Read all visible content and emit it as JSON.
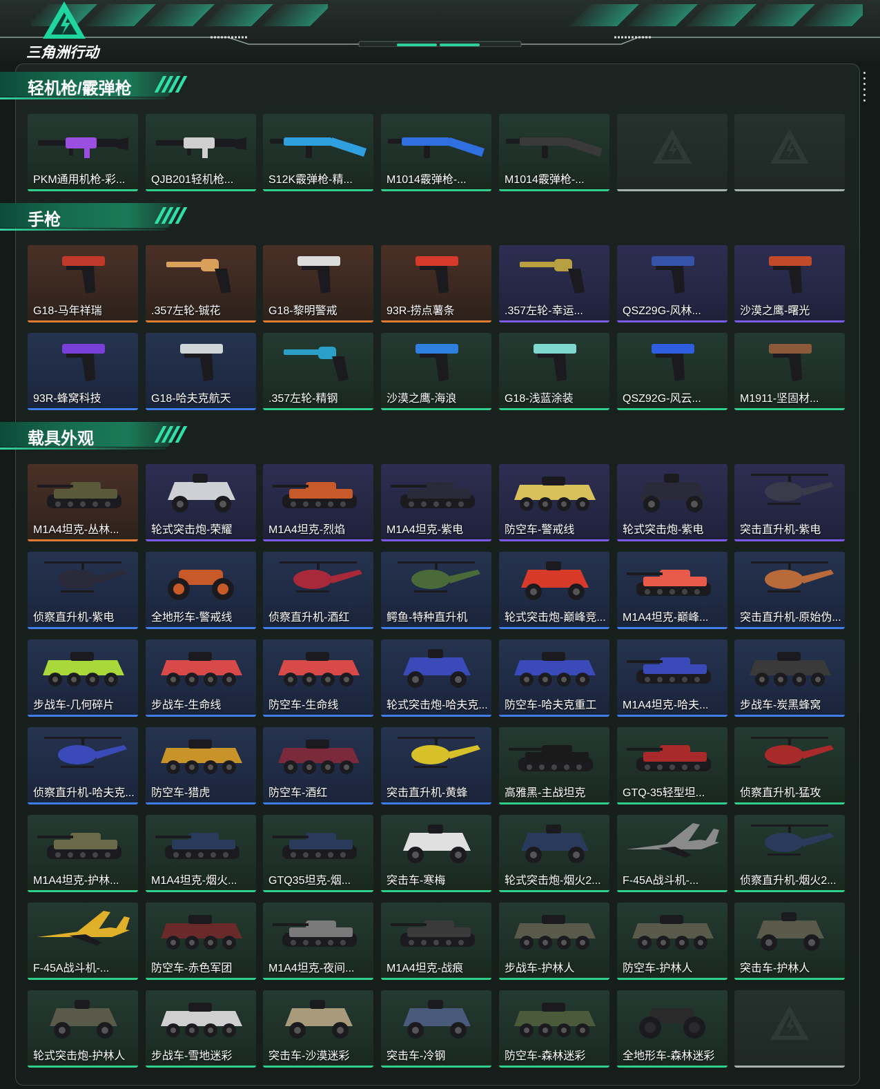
{
  "app": {
    "logo_text": "三角洲行动",
    "logo_icon": "delta-triangle-icon"
  },
  "sections": [
    {
      "title": "轻机枪/霰弹枪",
      "items": [
        {
          "name": "PKM通用机枪-彩...",
          "rarity": "green",
          "icon": "machine-gun-icon",
          "color": "#9a4fe0"
        },
        {
          "name": "QJB201轻机枪...",
          "rarity": "green",
          "icon": "machine-gun-icon",
          "color": "#cfcfcf"
        },
        {
          "name": "S12K霰弹枪-精...",
          "rarity": "green",
          "icon": "shotgun-icon",
          "color": "#2f9fe0"
        },
        {
          "name": "M1014霰弹枪-...",
          "rarity": "green",
          "icon": "shotgun-icon",
          "color": "#2f6fe0"
        },
        {
          "name": "M1014霰弹枪-...",
          "rarity": "green",
          "icon": "shotgun-icon",
          "color": "#3a3a3a"
        },
        {
          "name": "",
          "rarity": "empty",
          "icon": "empty-slot-icon",
          "color": ""
        },
        {
          "name": "",
          "rarity": "empty",
          "icon": "empty-slot-icon",
          "color": ""
        }
      ]
    },
    {
      "title": "手枪",
      "items": [
        {
          "name": "G18-马年祥瑞",
          "rarity": "orange",
          "icon": "pistol-icon",
          "color": "#c0392b"
        },
        {
          "name": ".357左轮-铖花",
          "rarity": "orange",
          "icon": "revolver-icon",
          "color": "#d9a05b"
        },
        {
          "name": "G18-黎明警戒",
          "rarity": "orange",
          "icon": "pistol-icon",
          "color": "#dcdcdc"
        },
        {
          "name": "93R-捞点薯条",
          "rarity": "orange",
          "icon": "pistol-icon",
          "color": "#d63a2a"
        },
        {
          "name": ".357左轮-幸运...",
          "rarity": "purple",
          "icon": "revolver-icon",
          "color": "#b8a040"
        },
        {
          "name": "QSZ29G-风林...",
          "rarity": "purple",
          "icon": "pistol-icon",
          "color": "#3553a8"
        },
        {
          "name": "沙漠之鹰-曙光",
          "rarity": "purple",
          "icon": "pistol-icon",
          "color": "#c04a2a"
        },
        {
          "name": "93R-蜂窝科技",
          "rarity": "blue",
          "icon": "pistol-icon",
          "color": "#7a3fd8"
        },
        {
          "name": "G18-哈夫克航天",
          "rarity": "blue",
          "icon": "pistol-icon",
          "color": "#cfd6d8"
        },
        {
          "name": ".357左轮-精钢",
          "rarity": "green",
          "icon": "revolver-icon",
          "color": "#2a9fc8"
        },
        {
          "name": "沙漠之鹰-海浪",
          "rarity": "green",
          "icon": "pistol-icon",
          "color": "#2f7fe0"
        },
        {
          "name": "G18-浅蓝涂装",
          "rarity": "green",
          "icon": "pistol-icon",
          "color": "#7fd8cf"
        },
        {
          "name": "QSZ92G-风云...",
          "rarity": "green",
          "icon": "pistol-icon",
          "color": "#2f5fe0"
        },
        {
          "name": "M1911-坚固材...",
          "rarity": "green",
          "icon": "pistol-icon",
          "color": "#8a5a3a"
        }
      ]
    },
    {
      "title": "载具外观",
      "items": [
        {
          "name": "M1A4坦克-丛林...",
          "rarity": "orange",
          "icon": "tank-icon",
          "color": "#5a5a3a"
        },
        {
          "name": "轮式突击炮-荣耀",
          "rarity": "purple",
          "icon": "armored-car-icon",
          "color": "#cfcfd6"
        },
        {
          "name": "M1A4坦克-烈焰",
          "rarity": "purple",
          "icon": "tank-icon",
          "color": "#c85a2a"
        },
        {
          "name": "M1A4坦克-紫电",
          "rarity": "purple",
          "icon": "tank-icon",
          "color": "#2a2a3a"
        },
        {
          "name": "防空车-警戒线",
          "rarity": "purple",
          "icon": "apc-icon",
          "color": "#d8c05a"
        },
        {
          "name": "轮式突击炮-紫电",
          "rarity": "purple",
          "icon": "armored-car-icon",
          "color": "#2a2a3a"
        },
        {
          "name": "突击直升机-紫电",
          "rarity": "purple",
          "icon": "helicopter-icon",
          "color": "#3a3a4a"
        },
        {
          "name": "侦察直升机-紫电",
          "rarity": "blue",
          "icon": "helicopter-icon",
          "color": "#2a2a3a"
        },
        {
          "name": "全地形车-警戒线",
          "rarity": "blue",
          "icon": "atv-icon",
          "color": "#c85a2a"
        },
        {
          "name": "侦察直升机-酒红",
          "rarity": "blue",
          "icon": "helicopter-icon",
          "color": "#a82a3a"
        },
        {
          "name": "鳄鱼-特种直升机",
          "rarity": "blue",
          "icon": "helicopter-icon",
          "color": "#4a6a3a"
        },
        {
          "name": "轮式突击炮-巅峰竞...",
          "rarity": "blue",
          "icon": "armored-car-icon",
          "color": "#d83a2a"
        },
        {
          "name": "M1A4坦克-巅峰...",
          "rarity": "blue",
          "icon": "tank-icon",
          "color": "#e85a4a"
        },
        {
          "name": "突击直升机-原始伪...",
          "rarity": "blue",
          "icon": "helicopter-icon",
          "color": "#b86a3a"
        },
        {
          "name": "步战车-几何碎片",
          "rarity": "blue",
          "icon": "apc-icon",
          "color": "#a8d83a"
        },
        {
          "name": "步战车-生命线",
          "rarity": "blue",
          "icon": "apc-icon",
          "color": "#d84a4a"
        },
        {
          "name": "防空车-生命线",
          "rarity": "blue",
          "icon": "apc-icon",
          "color": "#d84a4a"
        },
        {
          "name": "轮式突击炮-哈夫克...",
          "rarity": "blue",
          "icon": "armored-car-icon",
          "color": "#3a4ab8"
        },
        {
          "name": "防空车-哈夫克重工",
          "rarity": "blue",
          "icon": "apc-icon",
          "color": "#3a4ab8"
        },
        {
          "name": "M1A4坦克-哈夫...",
          "rarity": "blue",
          "icon": "tank-icon",
          "color": "#3a4ab8"
        },
        {
          "name": "步战车-炭黑蜂窝",
          "rarity": "blue",
          "icon": "apc-icon",
          "color": "#3a3a3a"
        },
        {
          "name": "侦察直升机-哈夫克...",
          "rarity": "blue",
          "icon": "helicopter-icon",
          "color": "#3a4ab8"
        },
        {
          "name": "防空车-猎虎",
          "rarity": "blue",
          "icon": "apc-icon",
          "color": "#c8942a"
        },
        {
          "name": "防空车-酒红",
          "rarity": "blue",
          "icon": "apc-icon",
          "color": "#7a2a3a"
        },
        {
          "name": "突击直升机-黄蜂",
          "rarity": "blue",
          "icon": "helicopter-icon",
          "color": "#d8c02a"
        },
        {
          "name": "高雅黑-主战坦克",
          "rarity": "green",
          "icon": "tank-icon",
          "color": "#1a1a1a"
        },
        {
          "name": "GTQ-35轻型坦...",
          "rarity": "green",
          "icon": "tank-icon",
          "color": "#a82a2a"
        },
        {
          "name": "侦察直升机-猛攻",
          "rarity": "green",
          "icon": "helicopter-icon",
          "color": "#a82a2a"
        },
        {
          "name": "M1A4坦克-护林...",
          "rarity": "green",
          "icon": "tank-icon",
          "color": "#6a6a4a"
        },
        {
          "name": "M1A4坦克-烟火...",
          "rarity": "green",
          "icon": "tank-icon",
          "color": "#2a3a5a"
        },
        {
          "name": "GTQ35坦克-烟...",
          "rarity": "green",
          "icon": "tank-icon",
          "color": "#2a3a5a"
        },
        {
          "name": "突击车-寒梅",
          "rarity": "green",
          "icon": "armored-car-icon",
          "color": "#e0e0e0"
        },
        {
          "name": "轮式突击炮-烟火2...",
          "rarity": "green",
          "icon": "armored-car-icon",
          "color": "#2a3a5a"
        },
        {
          "name": "F-45A战斗机-...",
          "rarity": "green",
          "icon": "jet-icon",
          "color": "#8a8a8a"
        },
        {
          "name": "侦察直升机-烟火2...",
          "rarity": "green",
          "icon": "helicopter-icon",
          "color": "#2a3a5a"
        },
        {
          "name": "F-45A战斗机-...",
          "rarity": "green",
          "icon": "jet-icon",
          "color": "#e0b02a"
        },
        {
          "name": "防空车-赤色军团",
          "rarity": "green",
          "icon": "apc-icon",
          "color": "#6a2a2a"
        },
        {
          "name": "M1A4坦克-夜间...",
          "rarity": "green",
          "icon": "tank-icon",
          "color": "#7a7a7a"
        },
        {
          "name": "M1A4坦克-战痕",
          "rarity": "green",
          "icon": "tank-icon",
          "color": "#3a3a3a"
        },
        {
          "name": "步战车-护林人",
          "rarity": "green",
          "icon": "apc-icon",
          "color": "#5a5a4a"
        },
        {
          "name": "防空车-护林人",
          "rarity": "green",
          "icon": "apc-icon",
          "color": "#5a5a4a"
        },
        {
          "name": "突击车-护林人",
          "rarity": "green",
          "icon": "armored-car-icon",
          "color": "#5a5a4a"
        },
        {
          "name": "轮式突击炮-护林人",
          "rarity": "green",
          "icon": "armored-car-icon",
          "color": "#5a5a4a"
        },
        {
          "name": "步战车-雪地迷彩",
          "rarity": "green",
          "icon": "apc-icon",
          "color": "#cfcfcf"
        },
        {
          "name": "突击车-沙漠迷彩",
          "rarity": "green",
          "icon": "armored-car-icon",
          "color": "#a89a7a"
        },
        {
          "name": "突击车-冷钢",
          "rarity": "green",
          "icon": "armored-car-icon",
          "color": "#4a5a7a"
        },
        {
          "name": "防空车-森林迷彩",
          "rarity": "green",
          "icon": "apc-icon",
          "color": "#4a5a3a"
        },
        {
          "name": "全地形车-森林迷彩",
          "rarity": "green",
          "icon": "atv-icon",
          "color": "#2a2a2a"
        },
        {
          "name": "",
          "rarity": "empty",
          "icon": "empty-slot-icon",
          "color": ""
        }
      ]
    }
  ]
}
